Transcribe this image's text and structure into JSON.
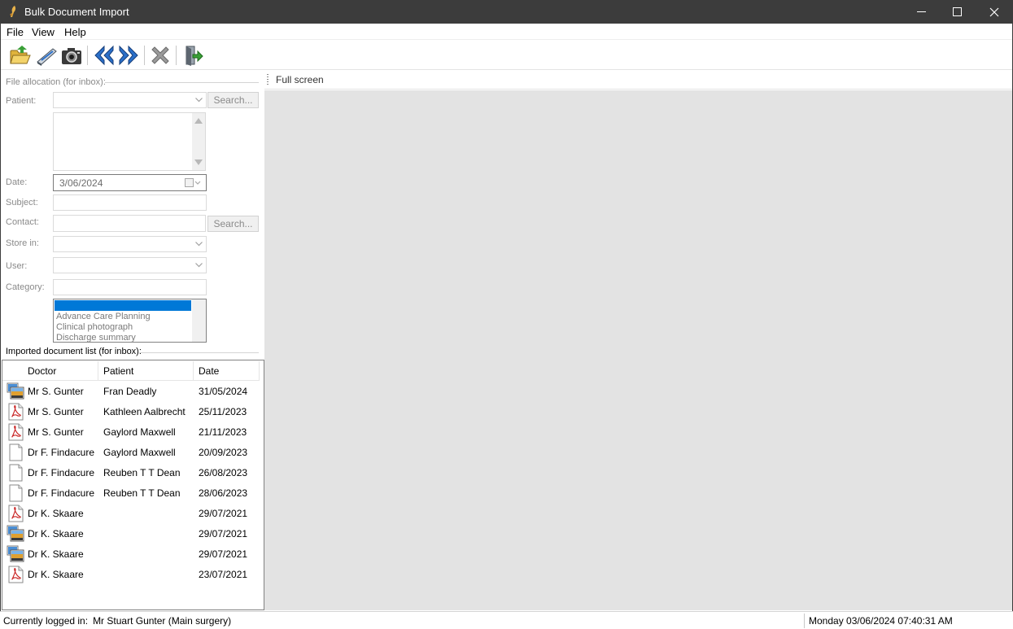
{
  "window": {
    "title": "Bulk Document Import",
    "controls": [
      "minimize-icon",
      "maximize-icon",
      "close-icon"
    ]
  },
  "menu": {
    "file": "File",
    "view": "View",
    "help": "Help"
  },
  "toolbar": {
    "buttons": [
      "open-folder-icon",
      "scanner-icon",
      "camera-icon",
      "previous-icon",
      "next-icon",
      "delete-icon",
      "exit-icon"
    ]
  },
  "allocation": {
    "group_title": "File allocation (for inbox):",
    "patient_label": "Patient:",
    "patient_value": "",
    "search_label": "Search...",
    "date_label": "Date:",
    "date_value": "3/06/2024",
    "subject_label": "Subject:",
    "subject_value": "",
    "contact_label": "Contact:",
    "contact_value": "",
    "contact_search_label": "Search...",
    "store_label": "Store in:",
    "store_value": "",
    "user_label": "User:",
    "user_value": "",
    "category_label": "Category:",
    "category_value": "",
    "category_options": [
      "",
      "Advance Care Planning",
      "Clinical photograph",
      "Discharge summary"
    ]
  },
  "imported": {
    "title": "Imported document list (for inbox):",
    "columns": {
      "doctor": "Doctor",
      "patient": "Patient",
      "date": "Date"
    },
    "rows": [
      {
        "icon": "image-file-icon",
        "doctor": "Mr S. Gunter",
        "patient": "Fran Deadly",
        "date": "31/05/2024"
      },
      {
        "icon": "pdf-file-icon",
        "doctor": "Mr S. Gunter",
        "patient": "Kathleen Aalbrecht",
        "date": "25/11/2023"
      },
      {
        "icon": "pdf-file-icon",
        "doctor": "Mr S. Gunter",
        "patient": "Gaylord Maxwell",
        "date": "21/11/2023"
      },
      {
        "icon": "blank-file-icon",
        "doctor": "Dr F. Findacure",
        "patient": "Gaylord Maxwell",
        "date": "20/09/2023"
      },
      {
        "icon": "blank-file-icon",
        "doctor": "Dr F. Findacure",
        "patient": "Reuben T T Dean",
        "date": "26/08/2023"
      },
      {
        "icon": "blank-file-icon",
        "doctor": "Dr F. Findacure",
        "patient": "Reuben T T Dean",
        "date": "28/06/2023"
      },
      {
        "icon": "pdf-file-icon",
        "doctor": "Dr K. Skaare",
        "patient": "",
        "date": "29/07/2021"
      },
      {
        "icon": "image-file-icon",
        "doctor": "Dr K. Skaare",
        "patient": "",
        "date": "29/07/2021"
      },
      {
        "icon": "image-file-icon",
        "doctor": "Dr K. Skaare",
        "patient": "",
        "date": "29/07/2021"
      },
      {
        "icon": "pdf-file-icon",
        "doctor": "Dr K. Skaare",
        "patient": "",
        "date": "23/07/2021"
      }
    ]
  },
  "preview": {
    "label": "Full screen"
  },
  "status": {
    "logged_in_label": "Currently logged in:",
    "user": "Mr Stuart Gunter (Main surgery)",
    "datetime": "Monday 03/06/2024 07:40:31 AM"
  },
  "colors": {
    "titlebar": "#3c3c3c",
    "selection": "#0078d7",
    "preview_bg": "#e3e3e3",
    "toolbar_arrows": "#2a6fc9"
  }
}
